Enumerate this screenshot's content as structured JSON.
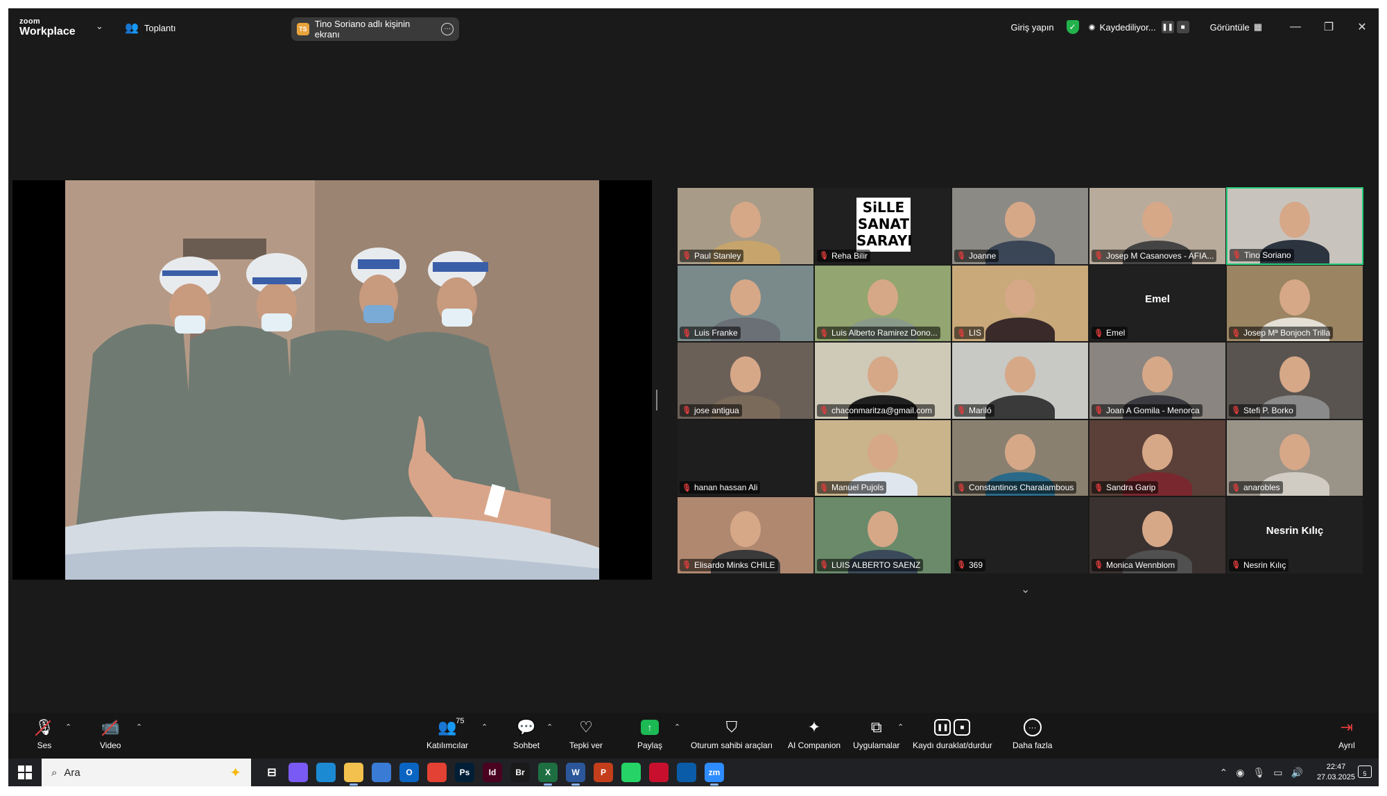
{
  "window": {
    "logo_top": "zoom",
    "logo_bottom": "Workplace",
    "meeting_label": "Toplantı",
    "share_badge": "TS",
    "share_text": "Tino Soriano adlı kişinin ekranı",
    "signin": "Giriş yapın",
    "recording": "Kaydediliyor...",
    "view": "Görüntüle"
  },
  "participants": [
    {
      "name": "Paul Stanley",
      "bg": "#a89c88",
      "body": "#c6a46b"
    },
    {
      "name": "Reha Bilir",
      "bg": "#202020",
      "logo": [
        "SiLLE",
        "SANAT",
        "SARAYI"
      ]
    },
    {
      "name": "Joanne",
      "bg": "#8c8a85",
      "body": "#3a4556"
    },
    {
      "name": "Josep M Casanoves - AFIA...",
      "bg": "#b8ab9c",
      "body": "#444444"
    },
    {
      "name": "Tino Soriano",
      "bg": "#c8c3bd",
      "body": "#2c3440",
      "active": true
    },
    {
      "name": "Luis Franke",
      "bg": "#7a8a8a",
      "body": "#6a7076"
    },
    {
      "name": "Luis Alberto Ramirez Dono...",
      "bg": "#93a570",
      "body": "#8a9a8a"
    },
    {
      "name": "LIS",
      "bg": "#c9a97a",
      "body": "#3a2a2a"
    },
    {
      "name": "Emel",
      "bg": "#202020",
      "center": "Emel"
    },
    {
      "name": "Josep Mª Bonjoch Trilla",
      "bg": "#9a8462",
      "body": "#e4e0d6"
    },
    {
      "name": "jose antigua",
      "bg": "#6b6058",
      "body": "#7a6a5a"
    },
    {
      "name": "chaconmaritza@gmail.com",
      "bg": "#cfc9b8",
      "body": "#202020"
    },
    {
      "name": "Mariló",
      "bg": "#c8c8c4",
      "body": "#3a3a3a"
    },
    {
      "name": "Joan A Gomila - Menorca",
      "bg": "#8a8580",
      "body": "#3a3a40"
    },
    {
      "name": "Stefi P. Borko",
      "bg": "#5a5450",
      "body": "#8a8a8a"
    },
    {
      "name": "hanan hassan Ali",
      "bg": "#1e1e1e"
    },
    {
      "name": "Manuel Pujols",
      "bg": "#c9b48c",
      "body": "#dfe6ee"
    },
    {
      "name": "Constantinos Charalambous",
      "bg": "#8a8070",
      "body": "#2a6a88"
    },
    {
      "name": "Sandra Garip",
      "bg": "#5a4038",
      "body": "#7a2830"
    },
    {
      "name": "anarobles",
      "bg": "#9a9388",
      "body": "#d0ccc4"
    },
    {
      "name": "Elisardo Minks  CHILE",
      "bg": "#b08870",
      "body": "#3a3a3a"
    },
    {
      "name": "LUIS ALBERTO SAENZ",
      "bg": "#6a8a6a",
      "body": "#3a4a5a"
    },
    {
      "name": "369",
      "bg": "#202020"
    },
    {
      "name": "Monica Wennblom",
      "bg": "#3a3230",
      "body": "#505050"
    },
    {
      "name": "Nesrin Kılıç",
      "bg": "#202020",
      "center": "Nesrin Kılıç"
    }
  ],
  "toolbar": {
    "audio": "Ses",
    "video": "Video",
    "participants": "Katılımcılar",
    "participants_count": "75",
    "chat": "Sohbet",
    "react": "Tepki ver",
    "share": "Paylaş",
    "host_tools": "Oturum sahibi araçları",
    "ai": "AI Companion",
    "apps": "Uygulamalar",
    "record": "Kaydı duraklat/durdur",
    "more": "Daha fazla",
    "leave": "Ayrıl"
  },
  "taskbar": {
    "search": "Ara",
    "apps": [
      {
        "id": "copilot",
        "label": "",
        "color": "#7a5af5"
      },
      {
        "id": "edge",
        "label": "",
        "color": "#1b8ad3"
      },
      {
        "id": "explorer",
        "label": "",
        "color": "#f2c14e"
      },
      {
        "id": "store",
        "label": "",
        "color": "#3a7bd5"
      },
      {
        "id": "outlook",
        "label": "O",
        "color": "#0a64c2"
      },
      {
        "id": "chrome",
        "label": "",
        "color": "#e34133"
      },
      {
        "id": "photoshop",
        "label": "Ps",
        "color": "#001e36"
      },
      {
        "id": "indesign",
        "label": "Id",
        "color": "#49021f"
      },
      {
        "id": "bridge",
        "label": "Br",
        "color": "#1a1a1a"
      },
      {
        "id": "excel",
        "label": "X",
        "color": "#1d6f42"
      },
      {
        "id": "word",
        "label": "W",
        "color": "#2b579a"
      },
      {
        "id": "powerpoint",
        "label": "P",
        "color": "#c43e1c"
      },
      {
        "id": "whatsapp",
        "label": "",
        "color": "#25d366"
      },
      {
        "id": "app-red",
        "label": "",
        "color": "#c8102e"
      },
      {
        "id": "app-blue",
        "label": "",
        "color": "#0a5ca8"
      },
      {
        "id": "zoom",
        "label": "zm",
        "color": "#2d8cff"
      }
    ],
    "time": "22:47",
    "date": "27.03.2025",
    "notifications": "5"
  }
}
